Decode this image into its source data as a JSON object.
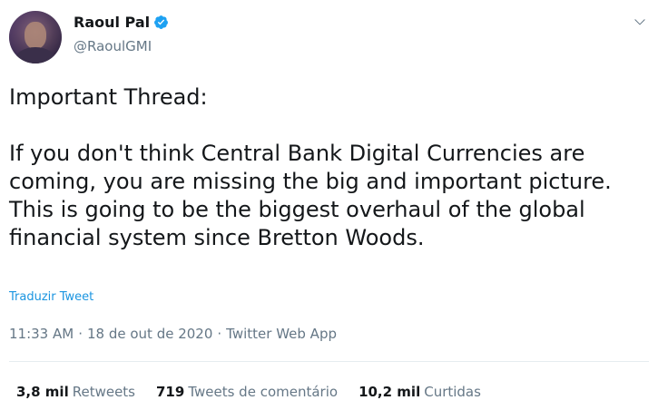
{
  "author": {
    "display_name": "Raoul Pal",
    "handle": "@RaoulGMI",
    "verified_icon": "verified-badge-icon",
    "avatar_icon": "avatar"
  },
  "menu_icon": "chevron-down-icon",
  "tweet": {
    "text": "Important Thread:\n\nIf you don't think Central Bank Digital Currencies are coming, you are missing the big and important picture. This is going to be the biggest overhaul of the global financial system since Bretton Woods.",
    "translate_label": "Traduzir Tweet"
  },
  "meta": {
    "time": "11:33 AM",
    "separator": "·",
    "date": "18 de out de 2020",
    "app": "Twitter Web App"
  },
  "stats": {
    "retweets": {
      "count": "3,8 mil",
      "label": "Retweets"
    },
    "comments": {
      "count": "719",
      "label": "Tweets de comentário"
    },
    "likes": {
      "count": "10,2 mil",
      "label": "Curtidas"
    }
  },
  "colors": {
    "link": "#1b95e0",
    "secondary_text": "#657786",
    "verified": "#1da1f2",
    "divider": "#e6ecf0"
  }
}
